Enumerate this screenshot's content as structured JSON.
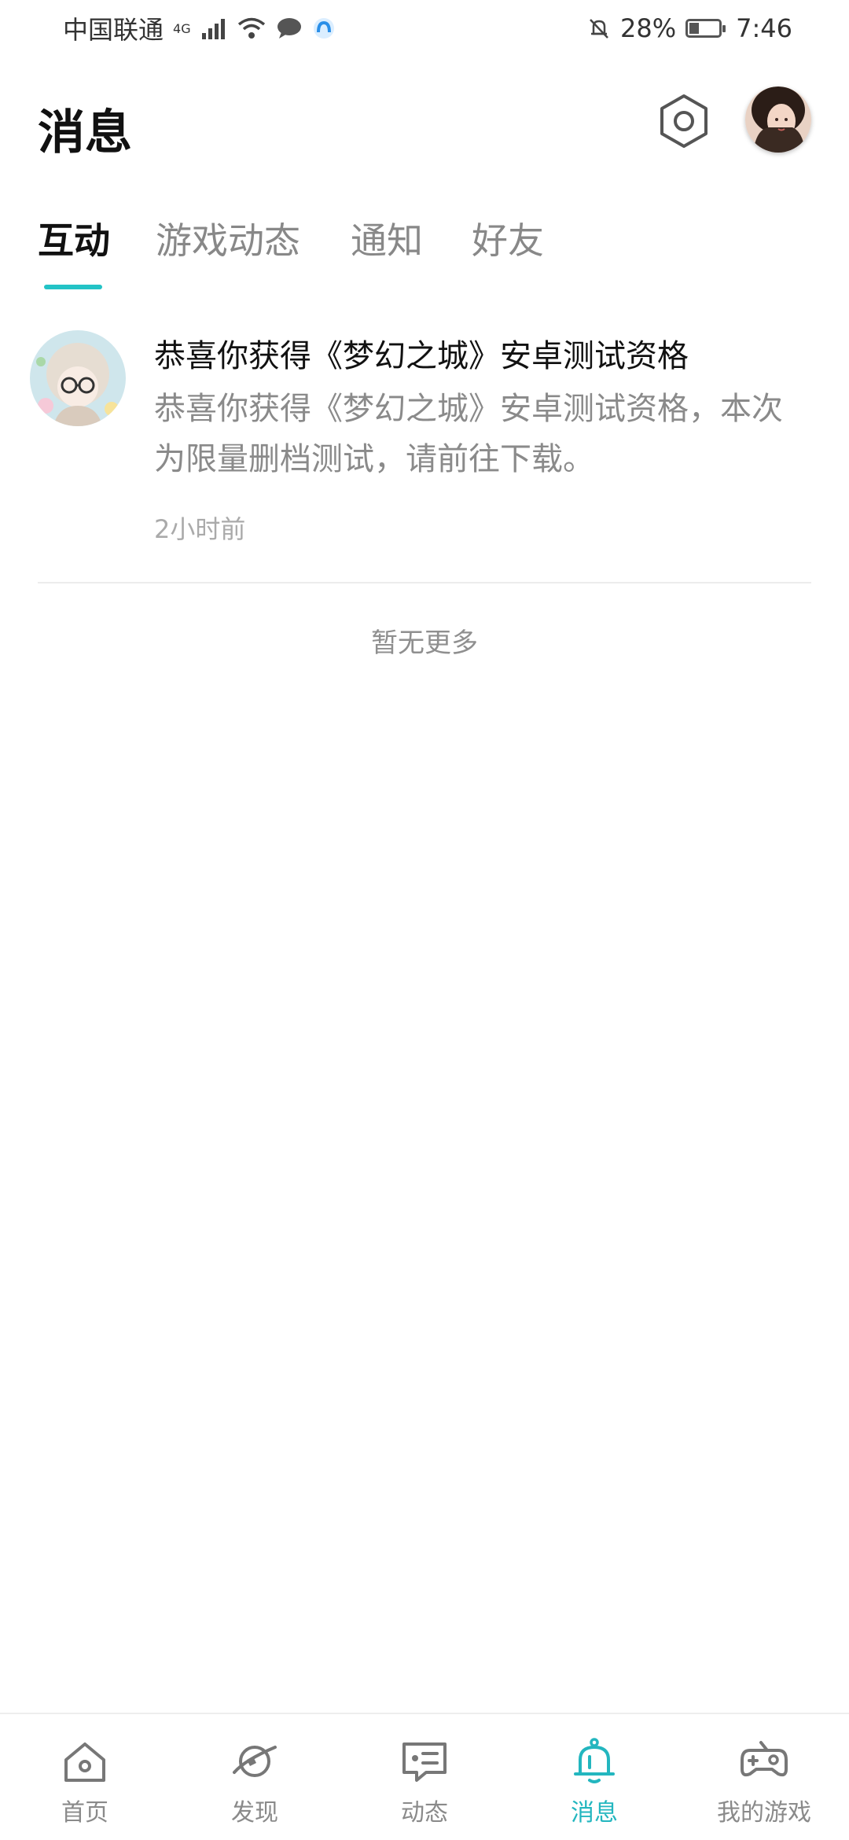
{
  "status_bar": {
    "carrier": "中国联通",
    "network": "4G",
    "battery": "28%",
    "time": "7:46"
  },
  "header": {
    "title": "消息"
  },
  "tabs": [
    {
      "label": "互动",
      "active": true
    },
    {
      "label": "游戏动态",
      "active": false
    },
    {
      "label": "通知",
      "active": false
    },
    {
      "label": "好友",
      "active": false
    }
  ],
  "messages": [
    {
      "title": "恭喜你获得《梦幻之城》安卓测试资格",
      "body": "恭喜你获得《梦幻之城》安卓测试资格，本次为限量删档测试，请前往下载。",
      "time": "2小时前"
    }
  ],
  "list_footer": "暂无更多",
  "bottom_nav": [
    {
      "label": "首页",
      "icon": "home-icon",
      "active": false
    },
    {
      "label": "发现",
      "icon": "planet-icon",
      "active": false
    },
    {
      "label": "动态",
      "icon": "chat-card-icon",
      "active": false
    },
    {
      "label": "消息",
      "icon": "bell-icon",
      "active": true
    },
    {
      "label": "我的游戏",
      "icon": "gamepad-icon",
      "active": false
    }
  ],
  "colors": {
    "accent": "#23c3c6",
    "text_primary": "#111111",
    "text_secondary": "#8a8a8a"
  }
}
